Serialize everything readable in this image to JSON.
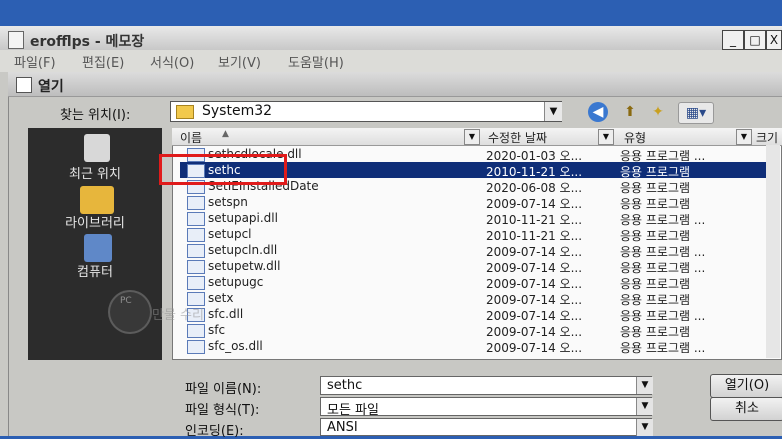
{
  "notepad": {
    "title": "erofflps - 메모장",
    "menu": [
      "파일(F)",
      "편집(E)",
      "서식(O)",
      "보기(V)",
      "도움말(H)"
    ],
    "buttons": {
      "minimize": "_",
      "maximize": "□",
      "close": "X"
    }
  },
  "dialog": {
    "title": "열기",
    "look_in_label": "찾는 위치(I):",
    "look_in_value": "System32",
    "places": [
      "최근 위치",
      "라이브러리",
      "컴퓨터"
    ],
    "columns": [
      "이름",
      "수정한 날짜",
      "유형",
      "크기"
    ],
    "files": [
      {
        "name": "sethcdlocale.dll",
        "date": "2020-01-03 오...",
        "type": "응용 프로그램 ...",
        "selected": false
      },
      {
        "name": "sethc",
        "date": "2010-11-21 오...",
        "type": "응용 프로그램",
        "selected": true
      },
      {
        "name": "SetIEInstalledDate",
        "date": "2020-06-08 오...",
        "type": "응용 프로그램",
        "selected": false
      },
      {
        "name": "setspn",
        "date": "2009-07-14 오...",
        "type": "응용 프로그램",
        "selected": false
      },
      {
        "name": "setupapi.dll",
        "date": "2010-11-21 오...",
        "type": "응용 프로그램 ...",
        "selected": false
      },
      {
        "name": "setupcl",
        "date": "2010-11-21 오...",
        "type": "응용 프로그램",
        "selected": false
      },
      {
        "name": "setupcln.dll",
        "date": "2009-07-14 오...",
        "type": "응용 프로그램 ...",
        "selected": false
      },
      {
        "name": "setupetw.dll",
        "date": "2009-07-14 오...",
        "type": "응용 프로그램 ...",
        "selected": false
      },
      {
        "name": "setupugc",
        "date": "2009-07-14 오...",
        "type": "응용 프로그램",
        "selected": false
      },
      {
        "name": "setx",
        "date": "2009-07-14 오...",
        "type": "응용 프로그램",
        "selected": false
      },
      {
        "name": "sfc.dll",
        "date": "2009-07-14 오...",
        "type": "응용 프로그램 ...",
        "selected": false
      },
      {
        "name": "sfc",
        "date": "2009-07-14 오...",
        "type": "응용 프로그램",
        "selected": false
      },
      {
        "name": "sfc_os.dll",
        "date": "2009-07-14 오...",
        "type": "응용 프로그램 ...",
        "selected": false
      }
    ],
    "filename_label": "파일 이름(N):",
    "filename_value": "sethc",
    "filetype_label": "파일 형식(T):",
    "filetype_value": "모든 파일",
    "encoding_label": "인코딩(E):",
    "encoding_value": "ANSI",
    "open_button": "열기(O)",
    "cancel_button": "취소"
  },
  "watermark": {
    "logo": "PC",
    "text": "만물 수리"
  },
  "colors": {
    "selection": "#0f2e78",
    "highlight_box": "#e01b1b"
  }
}
